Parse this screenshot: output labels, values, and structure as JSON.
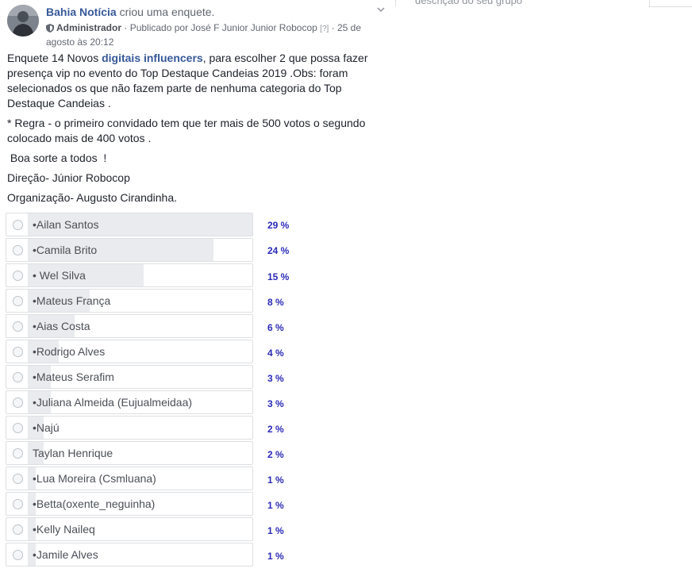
{
  "post": {
    "author": "Bahia Notícia",
    "action": "criou uma enquete.",
    "role": "Administrador",
    "published_by": "· Publicado por José F Junior Junior Robocop",
    "help": "[?]",
    "date": "· 25 de agosto às 20:12",
    "text": {
      "p1_before": "Enquete 14 Novos ",
      "p1_link": "digitais influencers",
      "p1_after": ", para escolher 2 que possa fazer presença vip no evento do Top Destaque Candeias 2019 .Obs: foram selecionados os que não fazem parte de nenhuma categoria do Top Destaque Candeias .",
      "p2": "* Regra - o primeiro convidado tem que ter mais de 500 votos o segundo colocado mais de 400 votos .",
      "p3": " Boa sorte a todos  !",
      "p4": "Direção- Júnior Robocop",
      "p5": "Organização- Augusto Cirandinha."
    }
  },
  "poll": {
    "options": [
      {
        "label": "•Ailan Santos",
        "percent_text": "29 %",
        "percent": 29
      },
      {
        "label": "•Camila Brito",
        "percent_text": "24 %",
        "percent": 24
      },
      {
        "label": "• Wel Silva",
        "percent_text": "15 %",
        "percent": 15
      },
      {
        "label": "•Mateus França",
        "percent_text": "8 %",
        "percent": 8
      },
      {
        "label": "•Aias Costa",
        "percent_text": "6 %",
        "percent": 6
      },
      {
        "label": "•Rodrigo Alves",
        "percent_text": "4 %",
        "percent": 4
      },
      {
        "label": "•Mateus Serafim",
        "percent_text": "3 %",
        "percent": 3
      },
      {
        "label": "•Juliana Almeida (Eujualmeidaa)",
        "percent_text": "3 %",
        "percent": 3
      },
      {
        "label": "•Najú",
        "percent_text": "2 %",
        "percent": 2
      },
      {
        "label": "Taylan Henrique",
        "percent_text": "2 %",
        "percent": 2
      },
      {
        "label": "•Lua Moreira (Csmluana)",
        "percent_text": "1 %",
        "percent": 1
      },
      {
        "label": "•Betta(oxente_neguinha)",
        "percent_text": "1 %",
        "percent": 1
      },
      {
        "label": "•Kelly Naileq",
        "percent_text": "1 %",
        "percent": 1
      },
      {
        "label": "•Jamile Alves",
        "percent_text": "1 %",
        "percent": 1
      }
    ]
  },
  "sidebar": {
    "group_description_placeholder": "descrição do seu grupo"
  },
  "icons": {
    "avatar": "profile-photo",
    "role": "shield-icon",
    "menu": "chevron-down-icon",
    "option": "radio-icon"
  },
  "colors": {
    "link": "#365899",
    "percent": "#2b2bb8",
    "bar_fill": "#e9ebee"
  }
}
